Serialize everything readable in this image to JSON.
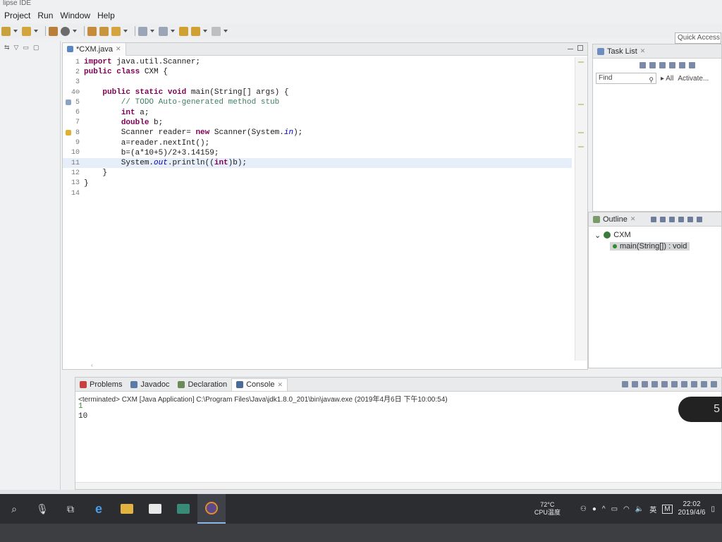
{
  "window": {
    "title": "lipse IDE"
  },
  "menu": [
    "Project",
    "Run",
    "Window",
    "Help"
  ],
  "quick_access": "Quick Access",
  "editor": {
    "tab_label": "*CXM.java",
    "lines": [
      {
        "n": "1",
        "code": "import java.util.Scanner;",
        "marker": ""
      },
      {
        "n": "2",
        "code": "public class CXM {",
        "marker": ""
      },
      {
        "n": "3",
        "code": "",
        "marker": ""
      },
      {
        "n": "4⊖",
        "code": "    public static void main(String[] args) {",
        "marker": ""
      },
      {
        "n": "5",
        "code": "        // TODO Auto-generated method stub",
        "marker": "task"
      },
      {
        "n": "6",
        "code": "        int a;",
        "marker": ""
      },
      {
        "n": "7",
        "code": "        double b;",
        "marker": ""
      },
      {
        "n": "8",
        "code": "        Scanner reader= new Scanner(System.in);",
        "marker": "warn"
      },
      {
        "n": "9",
        "code": "        a=reader.nextInt();",
        "marker": ""
      },
      {
        "n": "10",
        "code": "        b=(a*10+5)/2+3.14159;",
        "marker": ""
      },
      {
        "n": "11",
        "code": "        System.out.println((int)b);",
        "marker": ""
      },
      {
        "n": "12",
        "code": "    }",
        "marker": ""
      },
      {
        "n": "13",
        "code": "}",
        "marker": ""
      },
      {
        "n": "14",
        "code": "",
        "marker": ""
      }
    ],
    "highlighted_line": "11"
  },
  "task_list": {
    "title": "Task List",
    "find_placeholder": "Find",
    "all_label": "▸ All",
    "activate_label": "Activate..."
  },
  "outline": {
    "title": "Outline",
    "class_name": "CXM",
    "method": "main(String[]) : void"
  },
  "console": {
    "tabs": [
      "Problems",
      "Javadoc",
      "Declaration",
      "Console"
    ],
    "active_tab": "Console",
    "status": "<terminated> CXM [Java Application] C:\\Program Files\\Java\\jdk1.8.0_201\\bin\\javaw.exe (2019年4月6日 下午10:00:54)",
    "output": [
      {
        "text": "1",
        "type": "input"
      },
      {
        "text": "10",
        "type": "output"
      }
    ]
  },
  "overlay_digit": "5",
  "taskbar": {
    "temp": "72°C",
    "cpu_label": "CPU温度",
    "ime": "英",
    "time": "22:02",
    "date": "2019/4/6"
  },
  "colors": {
    "highlight_line": "#e6eefa",
    "keyword": "#7f0055",
    "comment": "#3f7f5f",
    "field": "#0000c0",
    "taskbar": "#2b2d30"
  }
}
